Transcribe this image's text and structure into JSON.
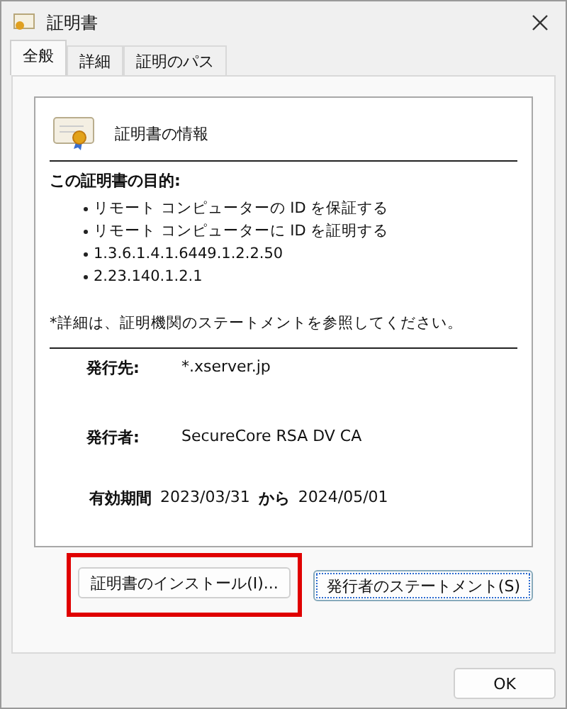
{
  "window": {
    "title": "証明書"
  },
  "tabs": [
    {
      "label": "全般",
      "selected": true
    },
    {
      "label": "詳細",
      "selected": false
    },
    {
      "label": "証明のパス",
      "selected": false
    }
  ],
  "info": {
    "heading": "証明書の情報",
    "purpose_title": "この証明書の目的:",
    "purposes": [
      "リモート コンピューターの ID を保証する",
      "リモート コンピューターに ID を証明する",
      "1.3.6.1.4.1.6449.1.2.2.50",
      "2.23.140.1.2.1"
    ],
    "note": "*詳細は、証明機関のステートメントを参照してください。",
    "issued_to_label": "発行先:",
    "issued_to": "*.xserver.jp",
    "issued_by_label": "発行者:",
    "issued_by": "SecureCore RSA DV CA",
    "validity_label": "有効期間",
    "valid_from": "2023/03/31",
    "from_word": "から",
    "valid_to": "2024/05/01"
  },
  "buttons": [
    {
      "label": "証明書のインストール(I)...",
      "highlighted": true,
      "focused": false
    },
    {
      "label": "発行者のステートメント(S)",
      "highlighted": false,
      "focused": true
    }
  ],
  "ok_button": "OK"
}
